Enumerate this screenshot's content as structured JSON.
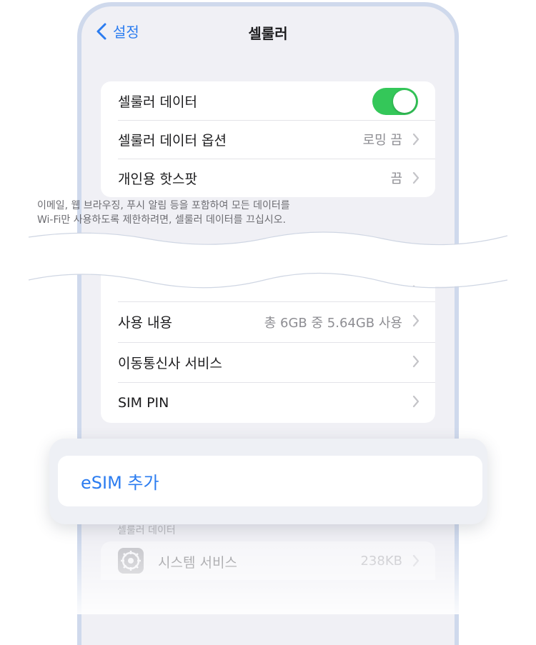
{
  "nav": {
    "back_label": "설정",
    "title": "셀룰러"
  },
  "section1": {
    "rows": [
      {
        "label": "셀룰러 데이터",
        "toggle_on": true
      },
      {
        "label": "셀룰러 데이터 옵션",
        "value": "로밍 끔"
      },
      {
        "label": "개인용 핫스팟",
        "value": "끔"
      }
    ],
    "footer_line1": "이메일, 웹 브라우징, 푸시 알림 등을 포함하여 모든 데이터를",
    "footer_line2": "Wi-Fi만 사용하도록 제한하려면, 셀룰러 데이터를 끄십시오."
  },
  "section2": {
    "rows": [
      {
        "label": "사용 내용",
        "value": "총 6GB 중 5.64GB 사용"
      },
      {
        "label": "이동통신사 서비스",
        "value": ""
      },
      {
        "label": "SIM PIN",
        "value": ""
      }
    ]
  },
  "esim": {
    "label": "eSIM 추가"
  },
  "usage_section": {
    "header": "셀룰러 데이터",
    "rows": [
      {
        "label": "시스템 서비스",
        "value": "238KB",
        "icon": "gear-icon"
      }
    ]
  },
  "colors": {
    "accent": "#2b7cf0",
    "toggle_on": "#34c759",
    "bezel": "#cfd9ec",
    "background": "#f0f0f5"
  }
}
